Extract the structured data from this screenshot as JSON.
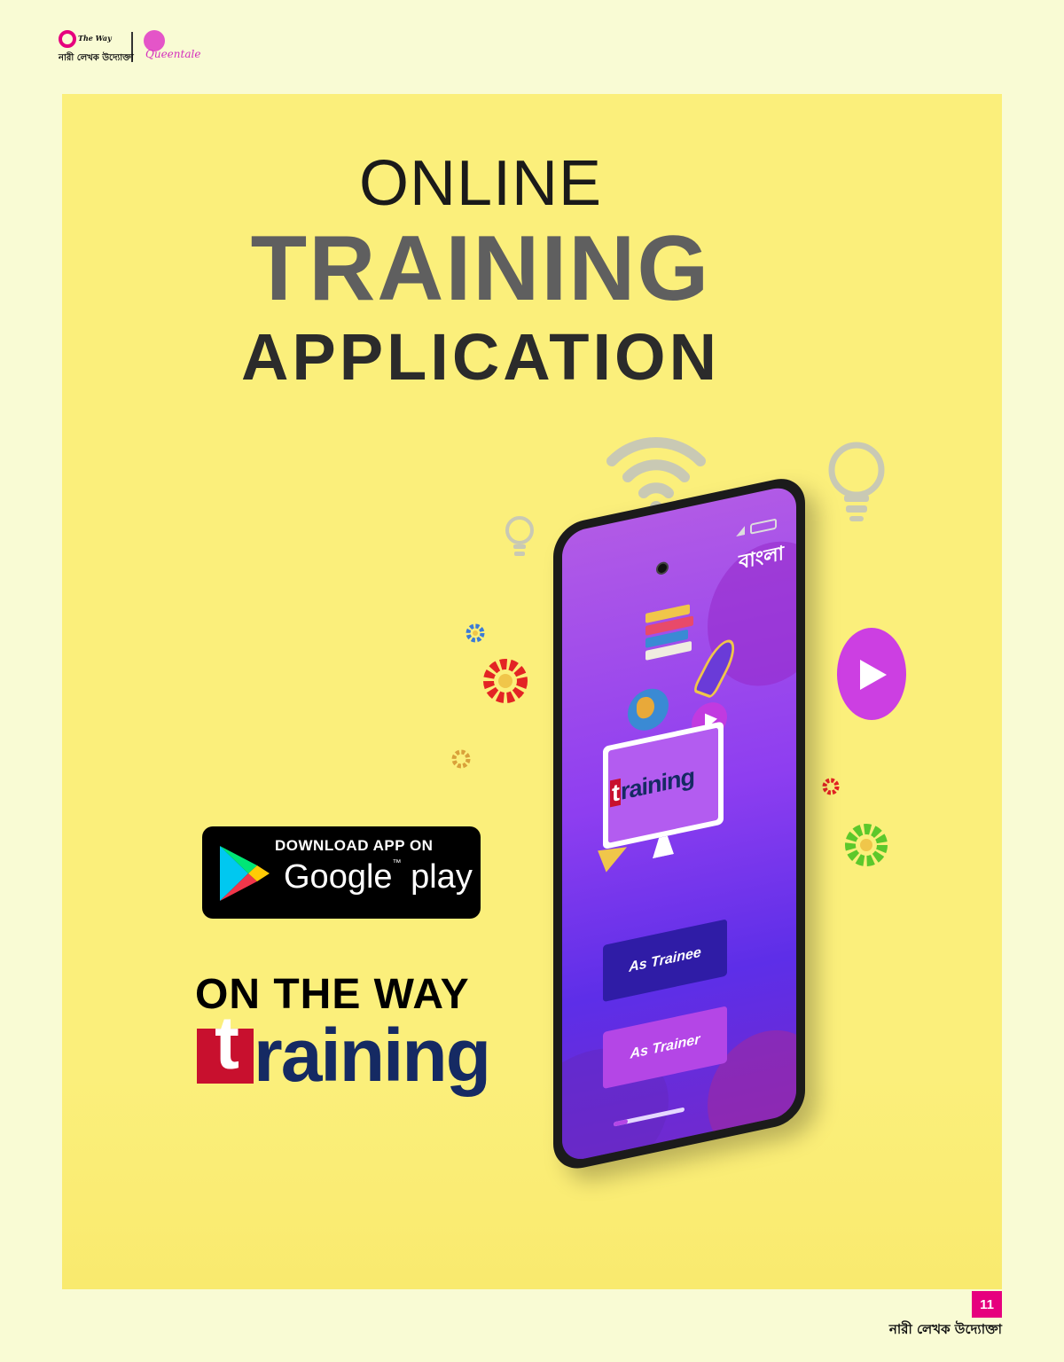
{
  "header": {
    "logo_left": {
      "english": "The Way",
      "bengali": "নারী লেখক উদ্যোক্তা"
    },
    "logo_right": {
      "name": "Queentale"
    }
  },
  "title": {
    "line1": "ONLINE",
    "line2": "TRAINING",
    "line3": "APPLICATION"
  },
  "store_badge": {
    "small": "DOWNLOAD APP ON",
    "big": "Google",
    "trademark": "™",
    "big_suffix": "play"
  },
  "brand": {
    "tagline": "ON THE WAY",
    "logo_first": "t",
    "logo_rest": "raining"
  },
  "phone": {
    "language_label": "বাংলা",
    "app_logo_first": "t",
    "app_logo_rest": "raining",
    "buttons": {
      "trainee": "As Trainee",
      "trainer": "As Trainer"
    },
    "loading_progress": 0.2
  },
  "icons": [
    "wifi-icon",
    "lightbulb-icon",
    "play-icon",
    "gear-icon"
  ],
  "colors": {
    "panel": "#fbef7b",
    "page_bg": "#f9fbd4",
    "accent_pink": "#e6007e",
    "brand_red": "#c8102e",
    "brand_navy": "#152a63",
    "phone_purple": "#8e3ef0"
  },
  "footer": {
    "page_number": "11",
    "bengali": "নারী লেখক উদ্যোক্তা"
  }
}
